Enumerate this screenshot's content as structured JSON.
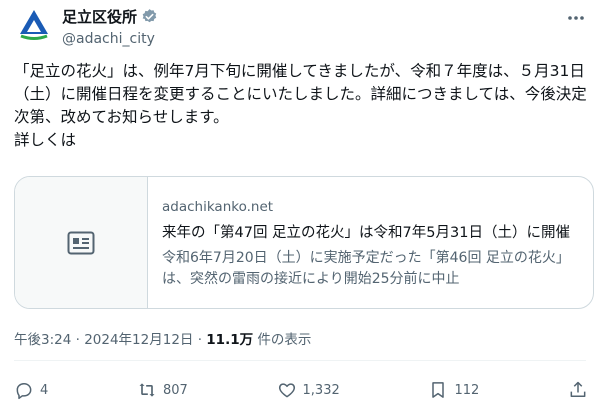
{
  "account": {
    "name": "足立区役所",
    "handle": "@adachi_city"
  },
  "tweet": {
    "text": "「足立の花火」は、例年7月下旬に開催してきましたが、令和７年度は、５月31日（土）に開催日程を変更することにいたしました。詳細につきましては、今後決定次第、改めてお知らせします。\n詳しくは"
  },
  "card": {
    "domain": "adachikanko.net",
    "title": "来年の「第47回 足立の花火」は令和7年5月31日（土）に開催",
    "description": "令和6年7月20日（土）に実施予定だった「第46回 足立の花火」は、突然の雷雨の接近により開始25分前に中止"
  },
  "meta": {
    "timestamp": "午後3:24 · 2024年12月12日 · ",
    "views_count": "11.1万",
    "views_label": " 件の表示"
  },
  "actions": {
    "replies": "4",
    "reposts": "807",
    "likes": "1,332",
    "bookmarks": "112"
  },
  "icons": {
    "logo": "adachi-logo",
    "verified": "verified-badge-icon",
    "more": "more-icon",
    "card_thumb": "article-icon",
    "reply": "reply-icon",
    "repost": "repost-icon",
    "like": "like-icon",
    "bookmark": "bookmark-icon",
    "share": "share-icon"
  },
  "colors": {
    "text": "#0f1419",
    "secondary": "#536471",
    "border": "#cfd9de",
    "verified": "#829aab",
    "logo_blue": "#1a5bb5",
    "logo_green": "#2ea84a"
  }
}
